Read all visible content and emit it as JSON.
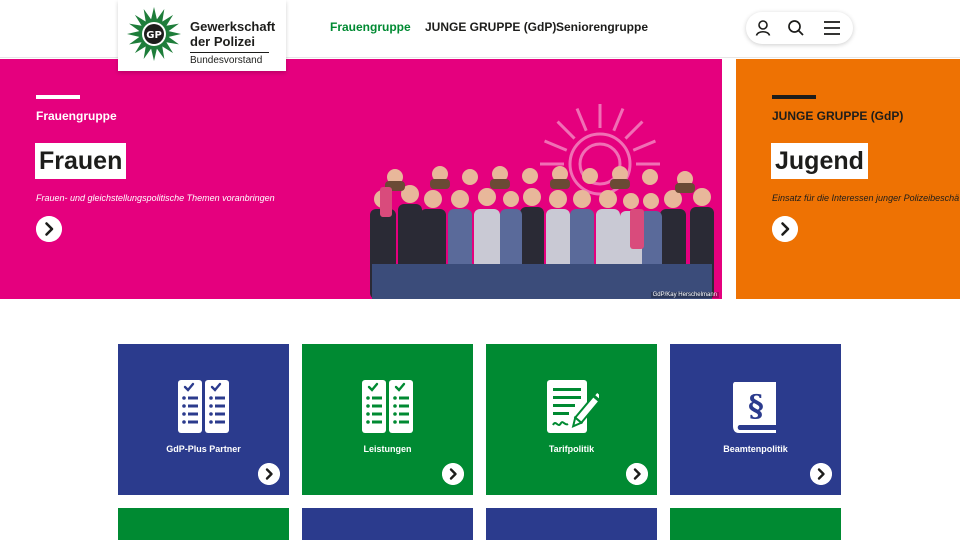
{
  "header": {
    "logo": {
      "line1": "Gewerkschaft",
      "line2": "der Polizei",
      "line3": "Bundesvorstand"
    },
    "nav": [
      {
        "label": "Frauengruppe",
        "active": true
      },
      {
        "label": "JUNGE GRUPPE (GdP)",
        "active": false
      },
      {
        "label": "Seniorengruppe",
        "active": false
      }
    ],
    "icons": [
      "user-icon",
      "search-icon",
      "menu-icon"
    ]
  },
  "hero": [
    {
      "kicker": "Frauengruppe",
      "title": "Frauen",
      "subtitle": "Frauen- und gleichstellungspolitische Themen voranbringen",
      "credit": "GdP/Kay Herschelmann",
      "color": "#e5007e"
    },
    {
      "kicker": "JUNGE GRUPPE (GdP)",
      "title": "Jugend",
      "subtitle": "Einsatz für die Interessen junger Polizeibeschä",
      "color": "#ee7203"
    }
  ],
  "tiles": [
    {
      "label": "GdP-Plus Partner",
      "color": "#2b3b8d",
      "icon": "checklist-icon"
    },
    {
      "label": "Leistungen",
      "color": "#008a32",
      "icon": "checklist-icon"
    },
    {
      "label": "Tarifpolitik",
      "color": "#008a32",
      "icon": "contract-icon"
    },
    {
      "label": "Beamtenpolitik",
      "color": "#2b3b8d",
      "icon": "law-book-icon"
    }
  ],
  "colors": {
    "green": "#008a32",
    "blue": "#2b3b8d",
    "pink": "#e5007e",
    "orange": "#ee7203"
  }
}
